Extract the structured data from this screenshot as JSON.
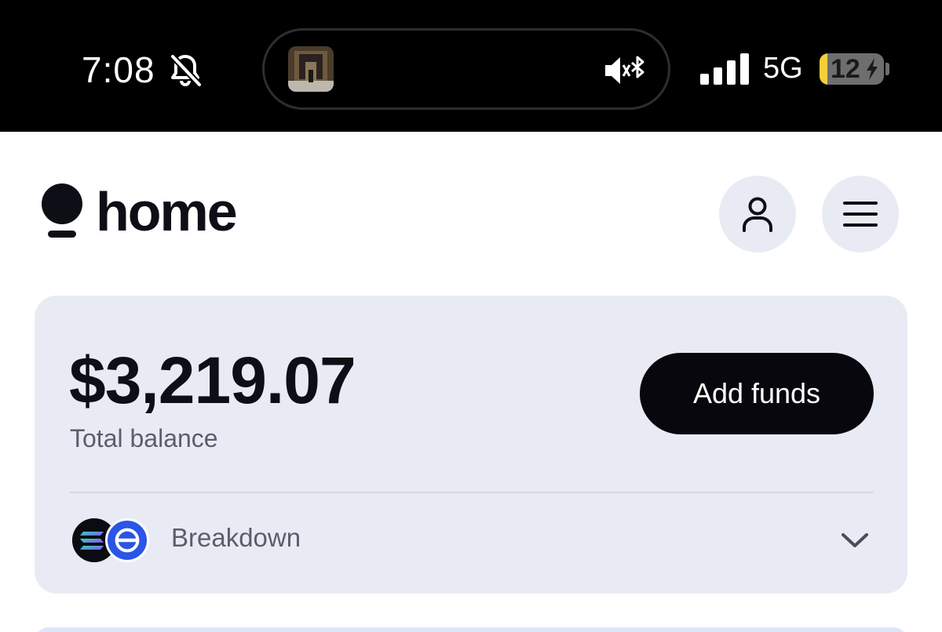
{
  "status_bar": {
    "time": "7:08",
    "network": "5G",
    "battery_level": "12",
    "battery_fraction": 0.12,
    "icons": [
      "bell-slash-icon",
      "album-art",
      "speaker-muted-icon",
      "bluetooth-icon",
      "signal-icon",
      "battery-charging-icon"
    ]
  },
  "header": {
    "brand": "home",
    "profile_icon": "person-icon",
    "menu_icon": "hamburger-icon"
  },
  "balance_card": {
    "amount": "$3,219.07",
    "label": "Total balance",
    "add_funds": "Add funds",
    "breakdown": "Breakdown",
    "token_icons": [
      "solana-icon",
      "usdc-icon"
    ],
    "chevron": "chevron-down-icon"
  },
  "colors": {
    "card_bg": "#e9ebf4",
    "button_bg": "#07070d",
    "muted_text": "#5b5d6b",
    "usdc_blue": "#2a55e6",
    "battery_yellow": "#f5cf3a"
  }
}
